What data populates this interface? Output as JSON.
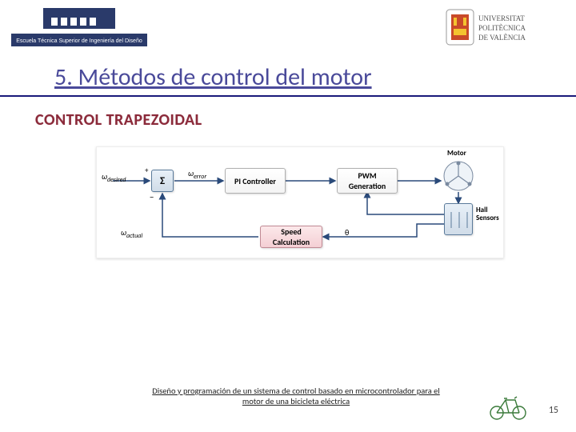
{
  "logos": {
    "left_text": "Escuela Técnica Superior de Ingeniería del Diseño",
    "right_text": "UNIVERSITAT POLITÈCNICA DE VALÈNCIA"
  },
  "title": "5. Métodos de control del motor",
  "subtitle": "CONTROL TRAPEZOIDAL",
  "diagram": {
    "omega_desired": "ω",
    "omega_desired_sub": "desired",
    "omega_error": "ω",
    "omega_error_sub": "error",
    "omega_actual": "ω",
    "omega_actual_sub": "actual",
    "plus": "+",
    "minus": "−",
    "sigma": "Σ",
    "theta": "θ",
    "block_pi": "PI Controller",
    "block_pwm": "PWM Generation",
    "block_speed": "Speed Calculation",
    "motor_label": "Motor",
    "hall_label": "Hall Sensors"
  },
  "footer_text": "Diseño y programación de un sistema de control basado en microcontrolador para el motor de una bicicleta eléctrica",
  "page_number": "15"
}
